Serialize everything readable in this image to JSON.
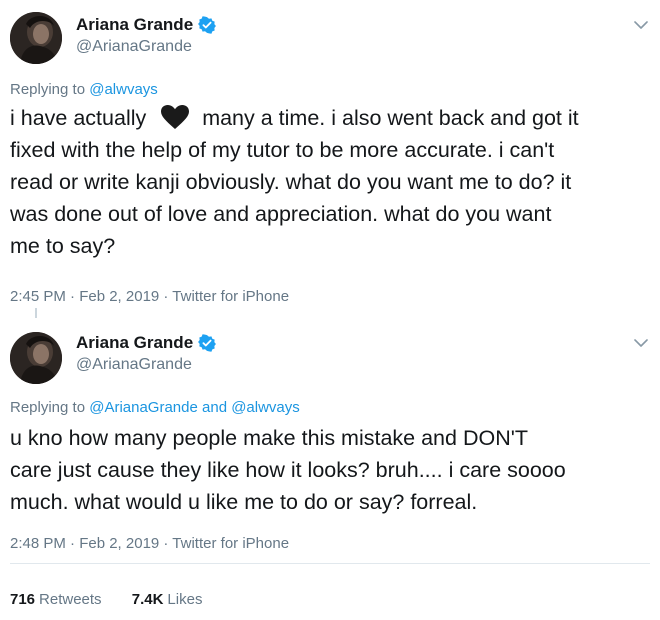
{
  "tweets": [
    {
      "display_name": "Ariana Grande",
      "handle": "@ArianaGrande",
      "replying_prefix": "Replying to ",
      "replying_mentions": "@alwvays",
      "body_lines": [
        [
          "i have actually ",
          " many a time. i also went back and got it"
        ],
        "fixed with the help of my tutor to be more accurate. i can't",
        "read or write kanji obviously. what do you want me to do? it",
        "was done out of love and appreciation. what do you want",
        "me to say?"
      ],
      "timestamp": "2:45 PM · Feb 2, 2019 · Twitter for iPhone"
    },
    {
      "display_name": "Ariana Grande",
      "handle": "@ArianaGrande",
      "replying_prefix": "Replying to ",
      "replying_mentions": "@ArianaGrande and @alwvays",
      "body_lines": [
        "u kno how many people make this mistake and DON'T",
        "care just cause they like how it looks? bruh.... i care soooo",
        "much. what would u like me to do or say? forreal."
      ],
      "timestamp": "2:48 PM · Feb 2, 2019 · Twitter for iPhone"
    }
  ],
  "stats": {
    "retweets_count": "716",
    "retweets_label": "Retweets",
    "likes_count": "7.4K",
    "likes_label": "Likes"
  },
  "icons": {
    "verified": "verified-badge-icon",
    "chevron": "chevron-down-icon",
    "heart": "black-heart-emoji-icon"
  },
  "colors": {
    "text": "#14171a",
    "muted": "#657786",
    "link": "#1b95e0",
    "verified": "#1da1f2",
    "divider": "#e1e8ed"
  }
}
